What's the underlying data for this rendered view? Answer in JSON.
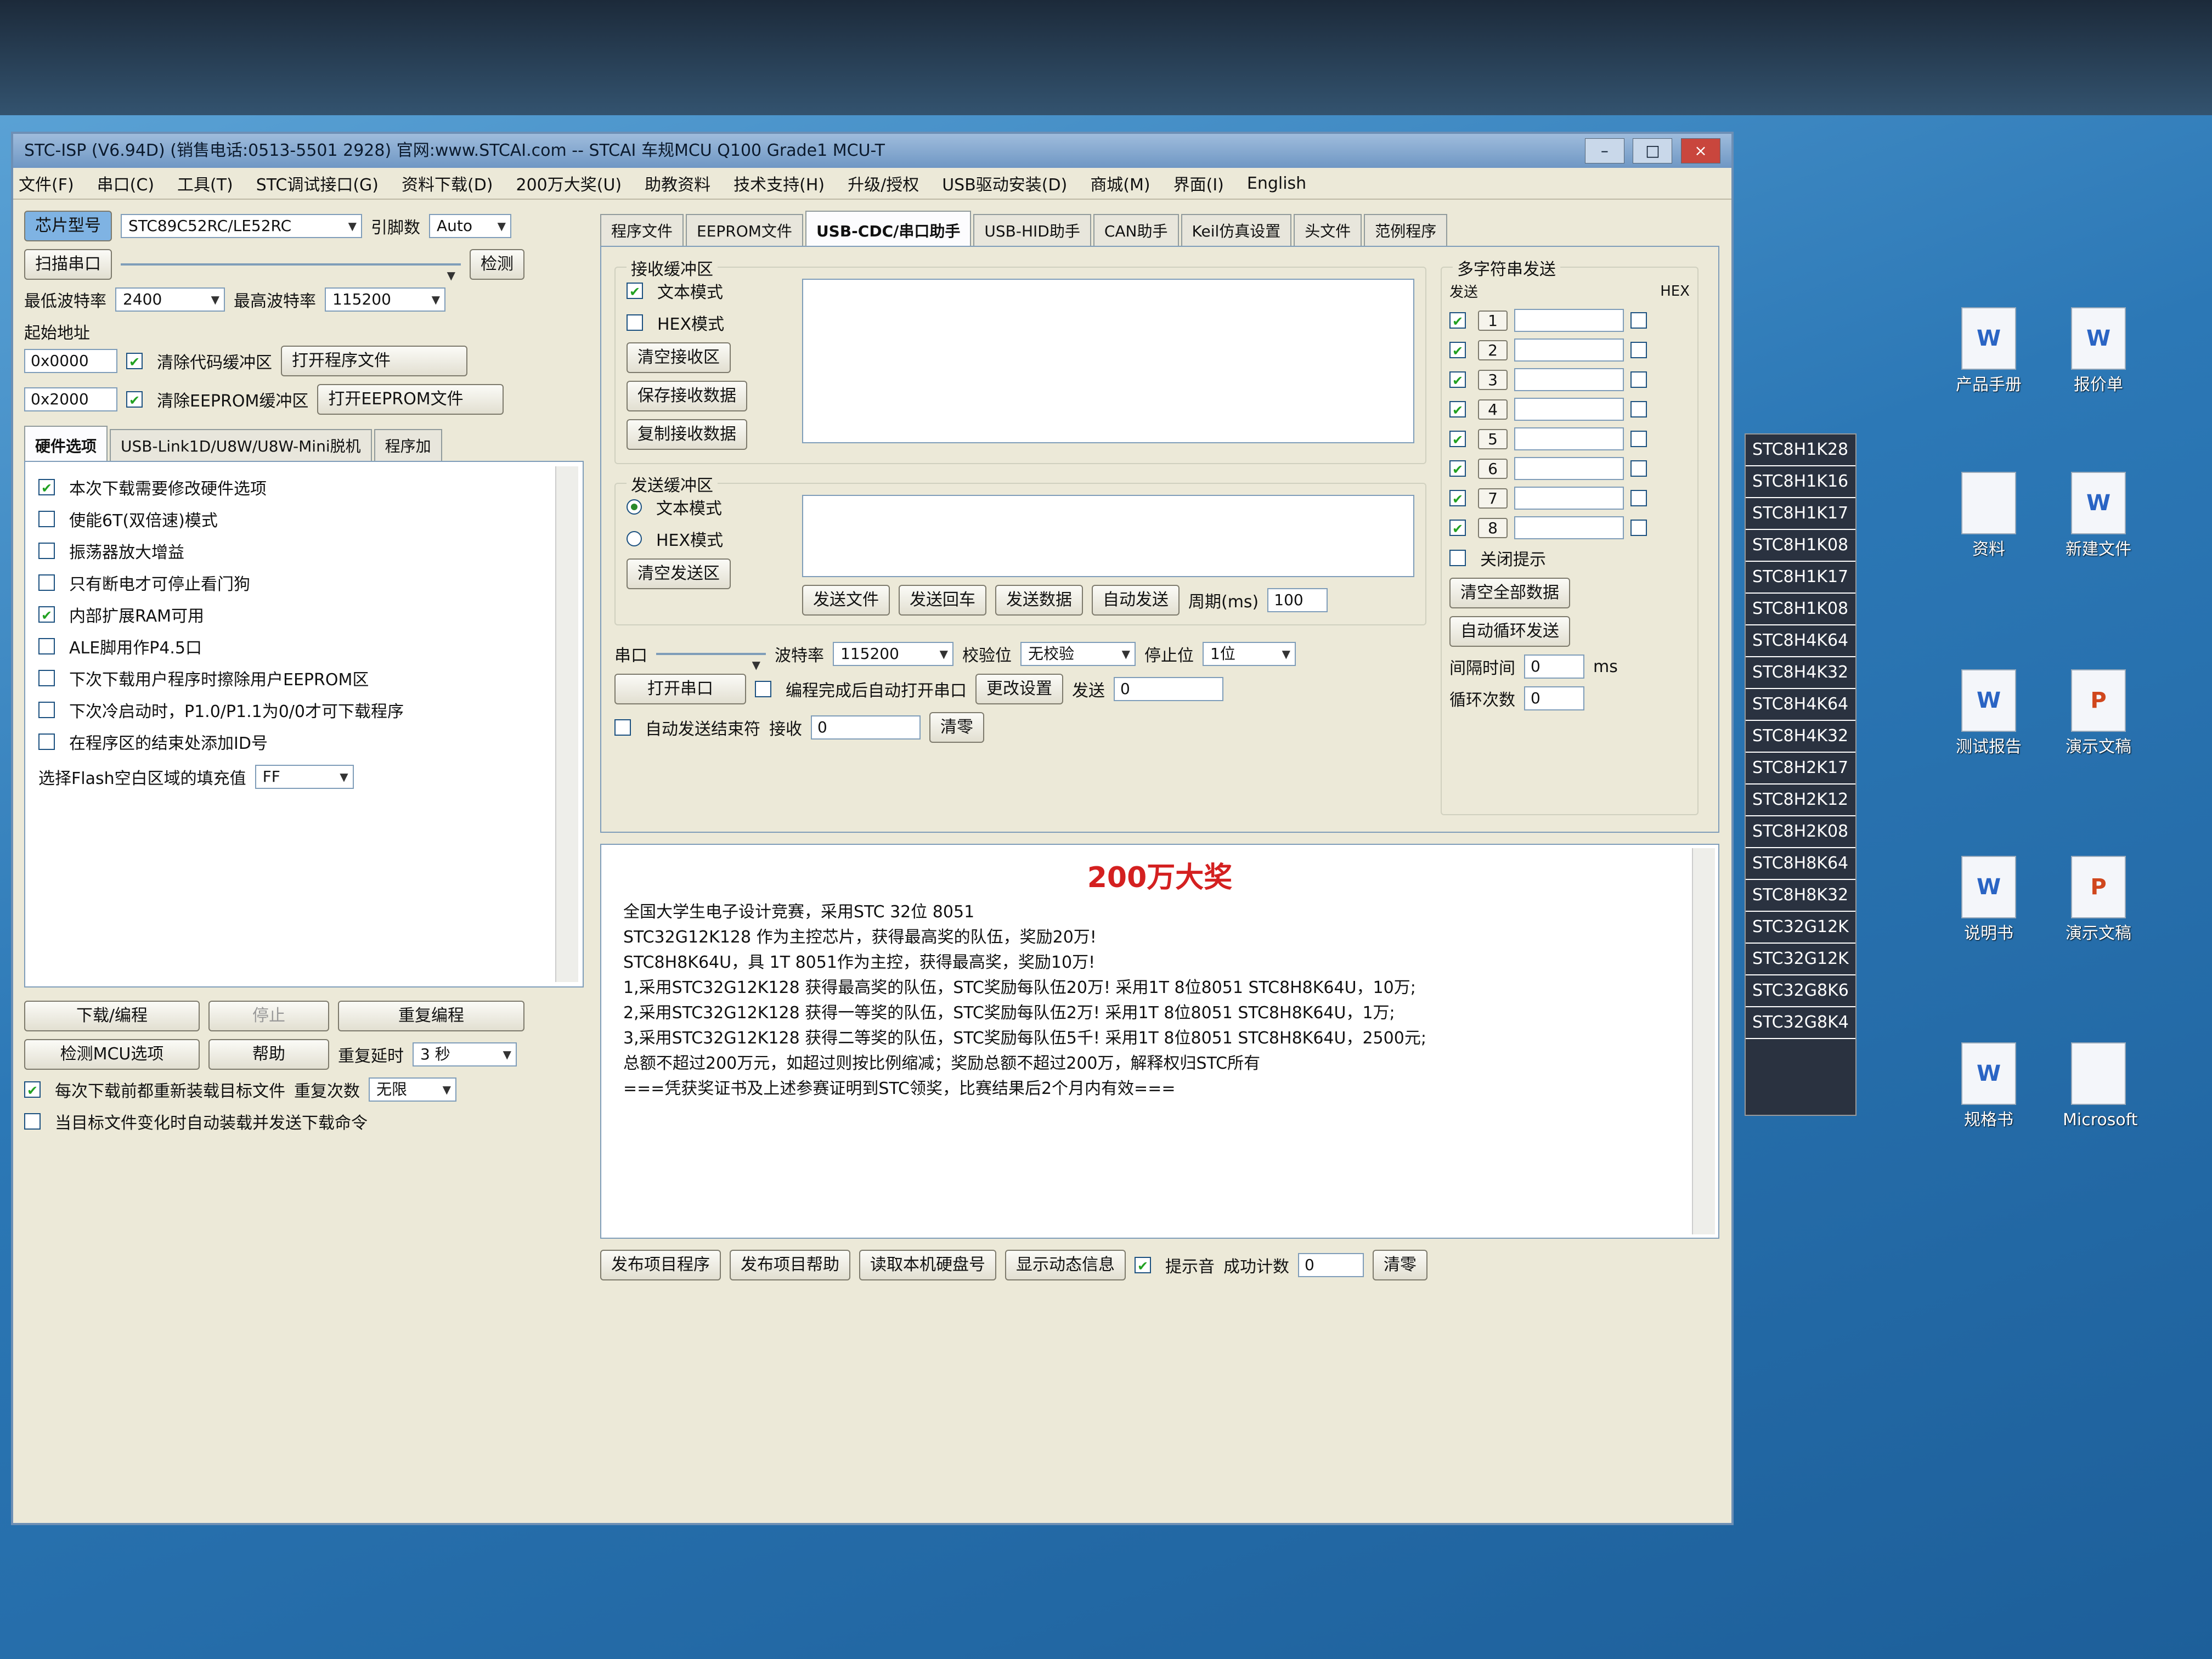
{
  "window": {
    "title": "STC-ISP (V6.94D) (销售电话:0513-5501 2928) 官网:www.STCAI.com  -- STCAI 车规MCU Q100 Grade1 MCU-T",
    "controls": {
      "minimize": "–",
      "maximize": "□",
      "close": "×"
    }
  },
  "menu": [
    "文件(F)",
    "串口(C)",
    "工具(T)",
    "STC调试接口(G)",
    "资料下载(D)",
    "200万大奖(U)",
    "助教资料",
    "技术支持(H)",
    "升级/授权",
    "USB驱动安装(D)",
    "商城(M)",
    "界面(I)",
    "English"
  ],
  "left": {
    "chip_label": "芯片型号",
    "chip_value": "STC89C52RC/LE52RC",
    "pins_label": "引脚数",
    "pins_value": "Auto",
    "scan_button": "扫描串口",
    "port_value": "",
    "check_button": "检测",
    "min_baud_label": "最低波特率",
    "min_baud": "2400",
    "max_baud_label": "最高波特率",
    "max_baud": "115200",
    "start_addr_label": "起始地址",
    "addr1": "0x0000",
    "clear_code": "清除代码缓冲区",
    "open_program": "打开程序文件",
    "addr2": "0x2000",
    "clear_eeprom": "清除EEPROM缓冲区",
    "open_eeprom": "打开EEPROM文件",
    "hw_tabs": [
      "硬件选项",
      "USB-Link1D/U8W/U8W-Mini脱机",
      "程序加"
    ],
    "hw_options": [
      {
        "label": "本次下载需要修改硬件选项",
        "checked": true
      },
      {
        "label": "使能6T(双倍速)模式",
        "checked": false
      },
      {
        "label": "振荡器放大增益",
        "checked": false
      },
      {
        "label": "只有断电才可停止看门狗",
        "checked": false
      },
      {
        "label": "内部扩展RAM可用",
        "checked": true
      },
      {
        "label": "ALE脚用作P4.5口",
        "checked": false
      },
      {
        "label": "下次下载用户程序时擦除用户EEPROM区",
        "checked": false
      },
      {
        "label": "下次冷启动时，P1.0/P1.1为0/0才可下载程序",
        "checked": false
      },
      {
        "label": "在程序区的结束处添加ID号",
        "checked": false
      }
    ],
    "fill_label": "选择Flash空白区域的填充值",
    "fill_value": "FF",
    "download_button": "下载/编程",
    "stop_button": "停止",
    "reprogram_button": "重复编程",
    "detect_button": "检测MCU选项",
    "help_button": "帮助",
    "delay_label": "重复延时",
    "delay_value": "3 秒",
    "repeat_label": "重复次数",
    "repeat_value": "无限",
    "reload_opt": "每次下载前都重新装载目标文件",
    "auto_send_opt": "当目标文件变化时自动装载并发送下载命令"
  },
  "right": {
    "tabs": [
      "程序文件",
      "EEPROM文件",
      "USB-CDC/串口助手",
      "USB-HID助手",
      "CAN助手",
      "Keil仿真设置",
      "头文件",
      "范例程序"
    ],
    "recv": {
      "title": "接收缓冲区",
      "text_mode": "文本模式",
      "hex_mode": "HEX模式",
      "clear": "清空接收区",
      "save": "保存接收数据",
      "copy": "复制接收数据"
    },
    "send": {
      "title": "发送缓冲区",
      "text_mode": "文本模式",
      "hex_mode": "HEX模式",
      "clear": "清空发送区",
      "send_file": "发送文件",
      "send_enter": "发送回车",
      "send_data": "发送数据",
      "auto_send": "自动发送",
      "period_label": "周期(ms)",
      "period_value": "100"
    },
    "serial": {
      "port_label": "串口",
      "port_value": "",
      "baud_label": "波特率",
      "baud_value": "115200",
      "parity_label": "校验位",
      "parity_value": "无校验",
      "stop_label": "停止位",
      "stop_value": "1位",
      "open_button": "打开串口",
      "opt1": "编程完成后自动打开串口",
      "opt2": "自动发送结束符",
      "change_button": "更改设置",
      "send_label": "发送",
      "send_count": "0",
      "recv_label": "接收",
      "recv_count": "0",
      "clear_count": "清零"
    },
    "multi": {
      "title": "多字符串发送",
      "col_send": "发送",
      "col_hex": "HEX",
      "rows": [
        "1",
        "2",
        "3",
        "4",
        "5",
        "6",
        "7",
        "8"
      ],
      "close_hint": "关闭提示",
      "clear_all": "清空全部数据",
      "auto_loop": "自动循环发送",
      "interval_label": "间隔时间",
      "interval_value": "0",
      "interval_unit": "ms",
      "loop_count_label": "循环次数",
      "loop_count_value": "0"
    }
  },
  "announce": {
    "headline": "200万大奖",
    "lines": [
      "全国大学生电子设计竞赛，采用STC 32位 8051",
      "STC32G12K128 作为主控芯片，获得最高奖的队伍，奖励20万!",
      "STC8H8K64U，具 1T 8051作为主控，获得最高奖，奖励10万!",
      "1,采用STC32G12K128 获得最高奖的队伍，STC奖励每队伍20万! 采用1T 8位8051 STC8H8K64U，10万;",
      "2,采用STC32G12K128 获得一等奖的队伍，STC奖励每队伍2万! 采用1T 8位8051 STC8H8K64U，1万;",
      "3,采用STC32G12K128 获得二等奖的队伍，STC奖励每队伍5千! 采用1T 8位8051 STC8H8K64U，2500元;",
      "总额不超过200万元，如超过则按比例缩减；奖励总额不超过200万，解释权归STC所有",
      "===凭获奖证书及上述参赛证明到STC领奖，比赛结果后2个月内有效==="
    ],
    "btn_publish": "发布项目程序",
    "btn_publish_help": "发布项目帮助",
    "btn_read_id": "读取本机硬盘号",
    "btn_show_dyn": "显示动态信息",
    "sound_label": "提示音",
    "success_label": "成功计数",
    "success_value": "0",
    "clear_button": "清零"
  },
  "chips": [
    "STC8H1K28",
    "STC8H1K16",
    "STC8H1K17",
    "STC8H1K08",
    "STC8H1K17",
    "STC8H1K08",
    "STC8H4K64",
    "STC8H4K32",
    "STC8H4K64",
    "STC8H4K32",
    "STC8H2K17",
    "STC8H2K12",
    "STC8H2K08",
    "STC8H8K64",
    "STC8H8K32",
    "STC32G12K",
    "STC32G12K",
    "STC32G8K6",
    "STC32G8K4"
  ],
  "desktop_icons": [
    {
      "label": "产品手册",
      "type": "w"
    },
    {
      "label": "报价单",
      "type": "w"
    },
    {
      "label": "资料",
      "type": "doc"
    },
    {
      "label": "新建文件",
      "type": "w"
    },
    {
      "label": "测试报告",
      "type": "w"
    },
    {
      "label": "演示文稿",
      "type": "p"
    },
    {
      "label": "说明书",
      "type": "w"
    },
    {
      "label": "演示文稿",
      "type": "p"
    },
    {
      "label": "规格书",
      "type": "w"
    },
    {
      "label": "Microsoft",
      "type": "doc"
    }
  ]
}
